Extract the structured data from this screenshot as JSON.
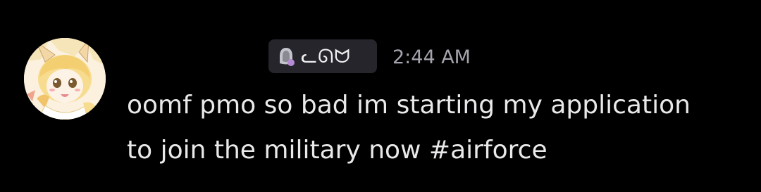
{
  "message": {
    "author_tag": "ᓚᘏᗢ",
    "timestamp": "2:44 AM",
    "lines": [
      "oomf pmo so bad im starting my application",
      "to join the military now #airforce"
    ]
  },
  "icons": {
    "avatar": "anime-avatar",
    "tag_badge": "guild-tag-icon"
  },
  "colors": {
    "background": "#000000",
    "message_text": "#e9e9ec",
    "timestamp": "#a4a4ad",
    "tag_background": "#25252b"
  }
}
